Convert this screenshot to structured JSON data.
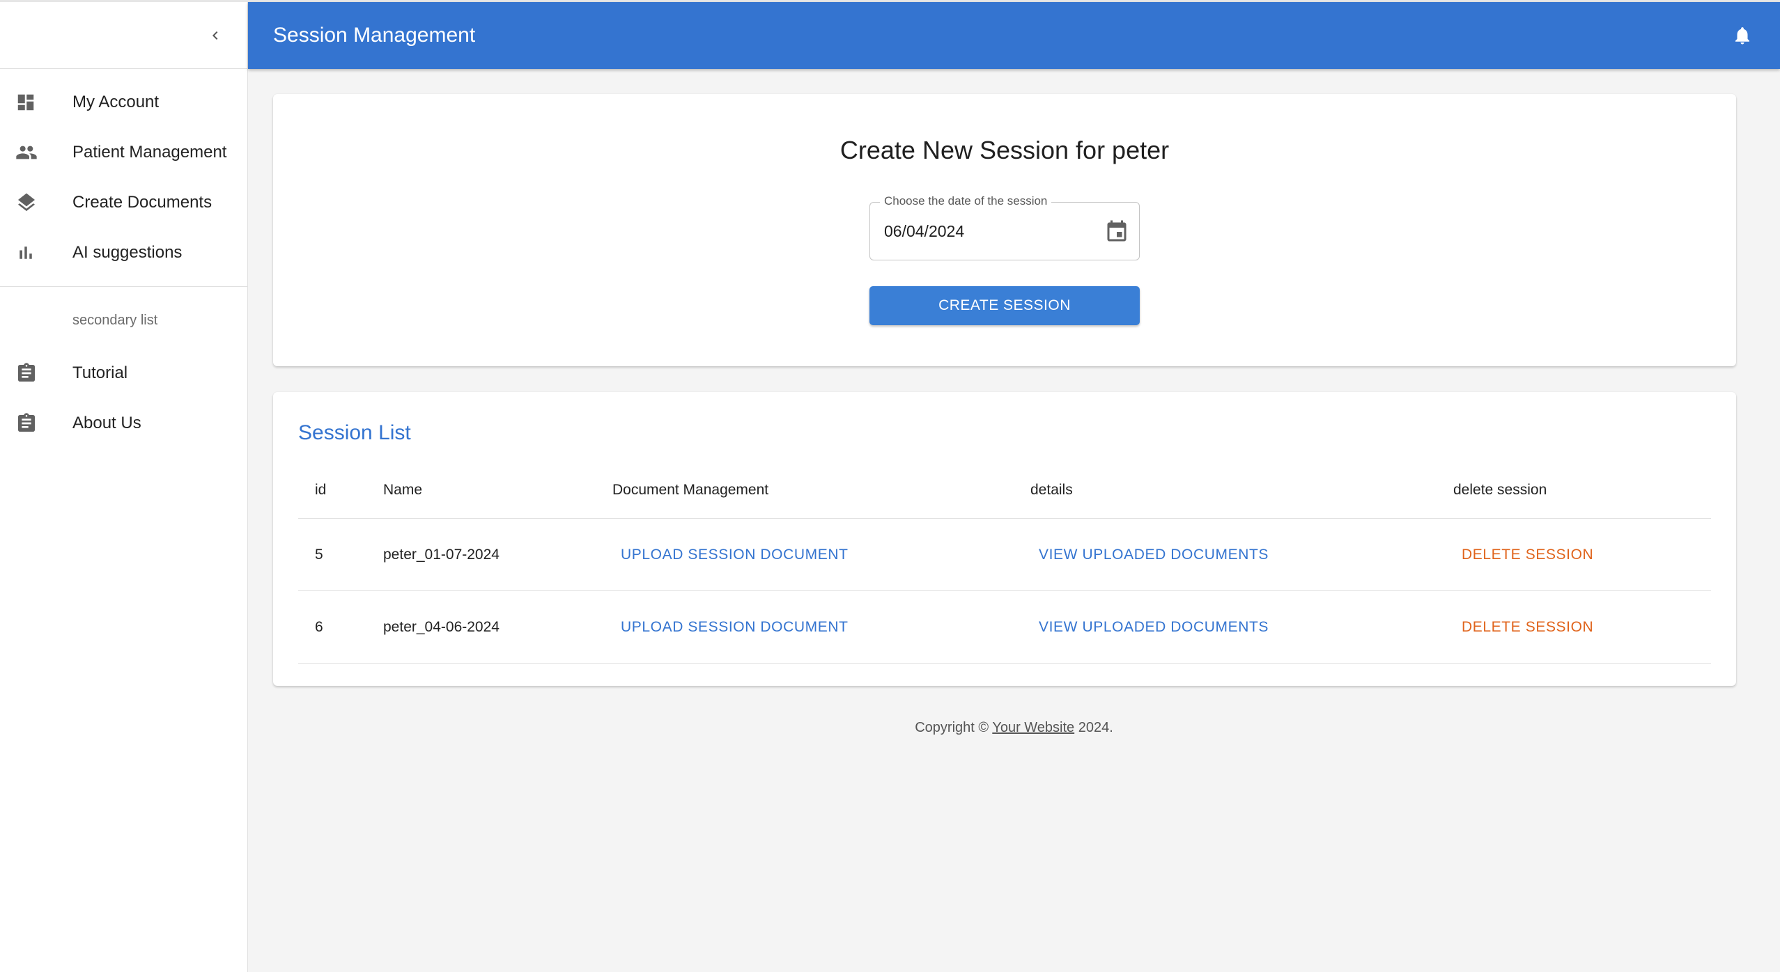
{
  "appbar": {
    "title": "Session Management",
    "notification_icon": "bell-icon"
  },
  "sidebar": {
    "collapse_icon": "chevron-left-icon",
    "items": [
      {
        "label": "My Account",
        "icon": "dashboard-icon"
      },
      {
        "label": "Patient Management",
        "icon": "people-icon"
      },
      {
        "label": "Create Documents",
        "icon": "layers-icon"
      },
      {
        "label": "AI suggestions",
        "icon": "bar-chart-icon"
      }
    ],
    "secondary_header": "secondary list",
    "secondary_items": [
      {
        "label": "Tutorial",
        "icon": "assignment-icon"
      },
      {
        "label": "About Us",
        "icon": "assignment-icon"
      }
    ]
  },
  "create": {
    "title": "Create New Session for peter",
    "date_label": "Choose the date of the session",
    "date_value": "06/04/2024",
    "button_label": "CREATE SESSION"
  },
  "sessions": {
    "title": "Session List",
    "headers": {
      "id": "id",
      "name": "Name",
      "doc": "Document Management",
      "details": "details",
      "delete": "delete session"
    },
    "rows": [
      {
        "id": "5",
        "name": "peter_01-07-2024",
        "upload": "UPLOAD SESSION DOCUMENT",
        "view": "VIEW UPLOADED DOCUMENTS",
        "delete": "DELETE SESSION"
      },
      {
        "id": "6",
        "name": "peter_04-06-2024",
        "upload": "UPLOAD SESSION DOCUMENT",
        "view": "VIEW UPLOADED DOCUMENTS",
        "delete": "DELETE SESSION"
      }
    ]
  },
  "footer": {
    "prefix": "Copyright © ",
    "link": "Your Website",
    "suffix": " 2024."
  },
  "colors": {
    "primary": "#3474d0",
    "danger": "#e0641c",
    "background": "#f4f4f4"
  }
}
